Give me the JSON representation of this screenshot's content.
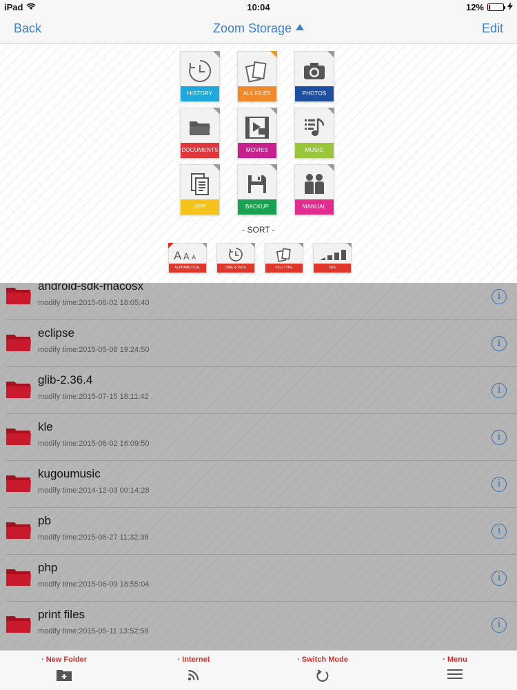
{
  "status_bar": {
    "device": "iPad",
    "time": "10:04",
    "battery": "12%",
    "battery_level": 0.12
  },
  "navbar": {
    "back_label": "Back",
    "title": "Zoom Storage",
    "edit_label": "Edit"
  },
  "categories": [
    {
      "label": "HISTORY",
      "icon": "history-icon",
      "color": "#1fa8dc"
    },
    {
      "label": "ALL FILES",
      "icon": "all-files-icon",
      "color": "#f1892d"
    },
    {
      "label": "PHOTOS",
      "icon": "camera-icon",
      "color": "#1f4fa0"
    },
    {
      "label": "DOCUMENTS",
      "icon": "folder-icon",
      "color": "#e0363c"
    },
    {
      "label": "MOVIES",
      "icon": "movie-icon",
      "color": "#c7218d"
    },
    {
      "label": "MUSIC",
      "icon": "music-icon",
      "color": "#9ac43a"
    },
    {
      "label": "APP",
      "icon": "app-icon",
      "color": "#f6c21c"
    },
    {
      "label": "BACKUP",
      "icon": "floppy-icon",
      "color": "#1aa152"
    },
    {
      "label": "MANUAL",
      "icon": "people-icon",
      "color": "#e32d8e"
    }
  ],
  "sort": {
    "title": "- SORT -",
    "options": [
      {
        "label": "ALPHABETICAL",
        "icon": "alphabetical-icon",
        "active": true
      },
      {
        "label": "TIME & DATE",
        "icon": "clock-icon",
        "active": false
      },
      {
        "label": "FILE TYPE",
        "icon": "file-type-icon",
        "active": false
      },
      {
        "label": "SIZE",
        "icon": "size-bars-icon",
        "active": false
      }
    ]
  },
  "files": [
    {
      "name": "android-sdk-macosx",
      "meta": "modify time:2015-06-02 18:05:40"
    },
    {
      "name": "eclipse",
      "meta": "modify time:2015-05-08 19:24:50"
    },
    {
      "name": "glib-2.36.4",
      "meta": "modify time:2015-07-15 18:11:42"
    },
    {
      "name": "kle",
      "meta": "modify time:2015-06-02 16:09:50"
    },
    {
      "name": "kugoumusic",
      "meta": "modify time:2014-12-03 00:14:28"
    },
    {
      "name": "pb",
      "meta": "modify time:2015-06-27 11:32:38"
    },
    {
      "name": "php",
      "meta": "modify time:2015-06-09 18:55:04"
    },
    {
      "name": "print files",
      "meta": "modify time:2015-05-11 13:52:58"
    }
  ],
  "toolbar": {
    "new_folder": "· New Folder",
    "internet": "· Internet",
    "switch_mode": "· Switch Mode",
    "menu": "· Menu"
  },
  "colors": {
    "accent": "#3b7fd6",
    "folder": "#c8192d",
    "toolbar_text": "#d0302a"
  }
}
